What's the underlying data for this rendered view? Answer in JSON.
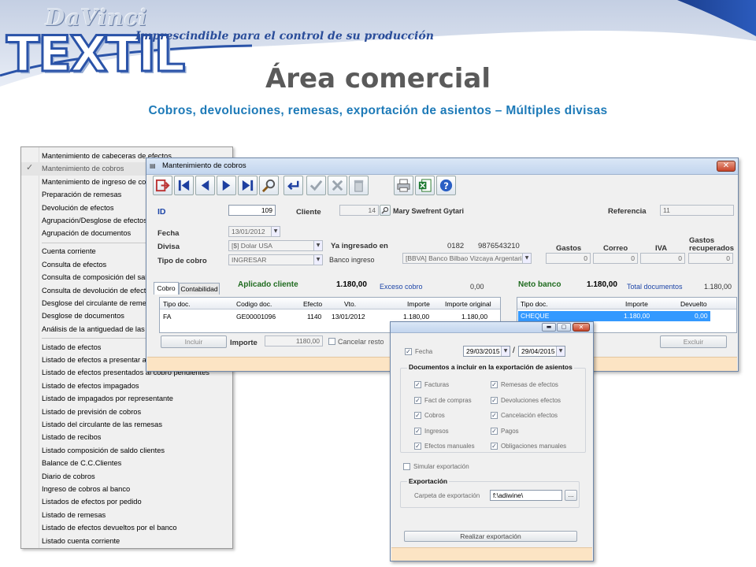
{
  "banner": {
    "logo_top": "DaVinci",
    "logo_main": "TEXTIL",
    "tagline": "Imprescindible para el control de su producción",
    "title": "Área comercial",
    "subtitle": "Cobros, devoluciones, remesas, exportación de asientos – Múltiples divisas",
    "colors": {
      "brand_blue": "#2a53a8",
      "subtitle": "#1d7ab8",
      "title": "#5a5a5a"
    }
  },
  "menu": {
    "items": [
      {
        "label": "Mantenimiento de cabeceras de efectos"
      },
      {
        "label": "Mantenimiento de cobros",
        "checked": true
      },
      {
        "label": "Mantenimiento de ingreso de cobros"
      },
      {
        "label": "Preparación de remesas"
      },
      {
        "label": "Devolución de efectos"
      },
      {
        "label": "Agrupación/Desglose de efectos"
      },
      {
        "label": "Agrupación de documentos",
        "sep_after": true
      },
      {
        "label": "Cuenta corriente"
      },
      {
        "label": "Consulta de efectos"
      },
      {
        "label": "Consulta de composición del saldo"
      },
      {
        "label": "Consulta de devolución de efectos"
      },
      {
        "label": "Desglose del circulante de remesas"
      },
      {
        "label": "Desglose de documentos"
      },
      {
        "label": "Análisis de la antiguedad de las deudas",
        "sep_after": true
      },
      {
        "label": "Listado de efectos"
      },
      {
        "label": "Listado de efectos a presentar al cobro"
      },
      {
        "label": "Listado de efectos presentados al cobro pendientes"
      },
      {
        "label": "Listado de efectos impagados"
      },
      {
        "label": "Listado de impagados por representante"
      },
      {
        "label": "Listado de previsión de cobros"
      },
      {
        "label": "Listado del circulante de las remesas"
      },
      {
        "label": "Listado de recibos"
      },
      {
        "label": "Listado composición de saldo clientes"
      },
      {
        "label": "Balance de  C.C.Clientes"
      },
      {
        "label": "Diario de cobros"
      },
      {
        "label": "Ingreso de cobros al banco"
      },
      {
        "label": "Listados de efectos por pedido"
      },
      {
        "label": "Listado de remesas"
      },
      {
        "label": "Listado de efectos devueltos por el banco"
      },
      {
        "label": "Listado cuenta corriente"
      }
    ],
    "check_icon": "✓"
  },
  "window": {
    "title": "Mantenimiento de cobros",
    "toolbar": [
      {
        "name": "exit-icon"
      },
      {
        "name": "first-record-icon"
      },
      {
        "name": "previous-record-icon"
      },
      {
        "name": "next-record-icon"
      },
      {
        "name": "last-record-icon"
      },
      {
        "name": "search-icon"
      },
      {
        "name": "enter-icon"
      },
      {
        "name": "accept-icon"
      },
      {
        "name": "cancel-icon"
      },
      {
        "name": "delete-icon"
      },
      {
        "name": "print-icon"
      },
      {
        "name": "excel-icon"
      },
      {
        "name": "help-icon"
      }
    ],
    "fields": {
      "id_label": "ID",
      "id_value": "109",
      "cliente_label": "Cliente",
      "cliente_code": "14",
      "cliente_name": "Mary Swefrent Gytari",
      "referencia_label": "Referencia",
      "referencia_value": "11",
      "fecha_label": "Fecha",
      "fecha_value": "13/01/2012",
      "divisa_label": "Divisa",
      "divisa_value": "[$] Dolar USA",
      "tipo_cobro_label": "Tipo de cobro",
      "tipo_cobro_value": "INGRESAR",
      "ya_ingresado_label": "Ya ingresado en",
      "cuenta_a": "0182",
      "cuenta_b": "9876543210",
      "banco_label": "Banco ingreso",
      "banco_value": "[BBVA] Banco Bilbao Vizcaya Argentaria",
      "gastos_label": "Gastos",
      "gastos_value": "0",
      "correo_label": "Correo",
      "correo_value": "0",
      "iva_label": "IVA",
      "iva_value": "0",
      "gastos_rec_label_1": "Gastos",
      "gastos_rec_label_2": "recuperados",
      "gastos_rec_value": "0"
    },
    "tabs": [
      "Cobro",
      "Contabilidad"
    ],
    "summary": {
      "aplicado_label": "Aplicado cliente",
      "aplicado_value": "1.180,00",
      "exceso_label": "Exceso cobro",
      "exceso_value": "0,00",
      "neto_label": "Neto banco",
      "neto_value": "1.180,00",
      "total_label": "Total documentos",
      "total_value": "1.180,00"
    },
    "docs_table": {
      "headers": [
        "Tipo doc.",
        "Codigo doc.",
        "Efecto",
        "Vto.",
        "Importe",
        "Importe original"
      ],
      "rows": [
        [
          "FA",
          "GE00001096",
          "1140",
          "13/01/2012",
          "1.180,00",
          "1.180,00"
        ]
      ]
    },
    "pay_table": {
      "headers": [
        "Tipo doc.",
        "Importe",
        "Devuelto"
      ],
      "rows": [
        [
          "CHEQUE",
          "1.180,00",
          "0,00"
        ]
      ]
    },
    "bottom": {
      "incluir": "Incluir",
      "importe_label": "Importe",
      "importe_value": "1180,00",
      "cancelar_resto": "Cancelar resto",
      "excluir": "Excluir"
    }
  },
  "dialog": {
    "fecha_label": "Fecha",
    "fecha_from": "29/03/2015",
    "fecha_sep": "/",
    "fecha_to": "29/04/2015",
    "docs_group_title": "Documentos a incluir en la exportación de asientos",
    "docs_left": [
      "Facturas",
      "Fact de compras",
      "Cobros",
      "Ingresos",
      "Efectos manuales"
    ],
    "docs_right": [
      "Remesas de efectos",
      "Devoluciones efectos",
      "Cancelación efectos",
      "Pagos",
      "Obligaciones manuales"
    ],
    "simular": "Simular exportación",
    "export_group_title": "Exportación",
    "carpeta_label": "Carpeta de exportación",
    "carpeta_value": "f:\\adiwine\\",
    "browse": "...",
    "run_button": "Realizar exportación"
  }
}
